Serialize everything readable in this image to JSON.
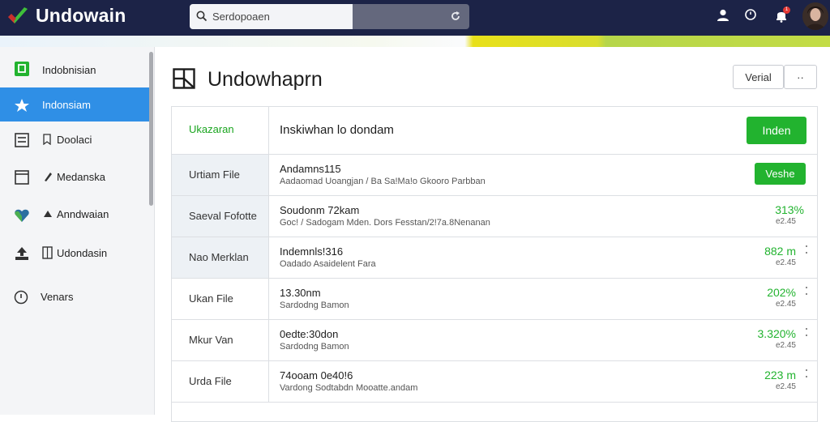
{
  "app": {
    "brand": "Undowain",
    "search_placeholder": "Serdopoaen",
    "notification_badge": "1",
    "colors": {
      "topbar": "#1c2347",
      "accent_blue": "#2f8fe6",
      "accent_green": "#22b32f"
    }
  },
  "sidebar": {
    "items": [
      {
        "label": "Indobnisian",
        "icon": "square-icon"
      },
      {
        "label": "Indonsiam",
        "icon": "star-icon",
        "active": true
      },
      {
        "label": "Doolaci",
        "icon": "list-icon"
      },
      {
        "label": "Medanska",
        "icon": "window-icon"
      },
      {
        "label": "Anndwaian",
        "icon": "heart-icon"
      },
      {
        "label": "Udondasin",
        "icon": "upload-icon"
      },
      {
        "label": "Venars",
        "icon": "info-icon"
      }
    ]
  },
  "main": {
    "title": "Undowhaprn",
    "view_button": "Verial",
    "more_button": "··",
    "panel": {
      "left_header": "Ukazaran",
      "right_header": "Inskiwhan lo dondam",
      "primary_button": "Inden",
      "rows": [
        {
          "left": "Urtiam File",
          "title": "Andamns115",
          "subtitle": "Aadaomad Uoangjan / Ba Sa!Ma!o Gkooro Parbban",
          "button": "Veshe"
        },
        {
          "left": "Saeval Fofotte",
          "title": "Soudonm 72kam",
          "subtitle": "Goc!  / Sadogam Mden. Dors Fesstan/2!7a.8Nenanan",
          "value": "313%",
          "subvalue": "e2.45"
        },
        {
          "left": "Nao Merklan",
          "title": "Indemnls!316",
          "subtitle": "Oadado Asaidelent Fara",
          "value": "882 m",
          "subvalue": "e2.45"
        },
        {
          "left": "Ukan File",
          "title": "13.30nm",
          "subtitle": "Sardodng Bamon",
          "value": "202%",
          "subvalue": "e2.45"
        },
        {
          "left": "Mkur Van",
          "title": "0edte:30don",
          "subtitle": "Sardodng Bamon",
          "value": "3.320%",
          "subvalue": "e2.45"
        },
        {
          "left": "Urda File",
          "title": "74ooam 0e40!6",
          "subtitle": "Vardong Sodtabdn Mooatte.andam",
          "value": "223 m",
          "subvalue": "e2.45"
        }
      ]
    }
  }
}
